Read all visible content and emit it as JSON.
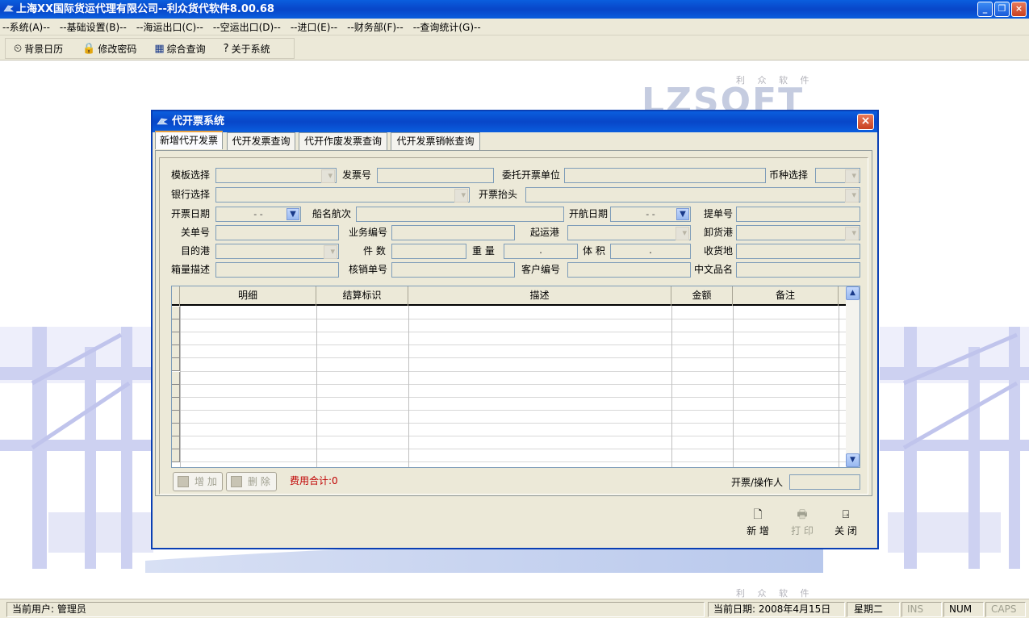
{
  "window": {
    "title": "上海XX国际货运代理有限公司--利众货代软件8.00.68"
  },
  "menu": [
    "--系统(A)--",
    "--基础设置(B)--",
    "--海运出口(C)--",
    "--空运出口(D)--",
    "--进口(E)--",
    "--财务部(F)--",
    "--查询统计(G)--"
  ],
  "toolbar": {
    "calendar": "背景日历",
    "password": "修改密码",
    "query": "综合查询",
    "about": "关于系统"
  },
  "logo": {
    "text": "LZSOFT",
    "sub": "利 众 软 件"
  },
  "dialog": {
    "title": "代开票系统",
    "tabs": [
      "新增代开发票",
      "代开发票查询",
      "代开作废发票查询",
      "代开发票销帐查询"
    ],
    "labels": {
      "template": "模板选择",
      "invoice_no": "发票号",
      "entrust_unit": "委托开票单位",
      "currency": "币种选择",
      "bank": "银行选择",
      "invoice_header": "开票抬头",
      "invoice_date": "开票日期",
      "vessel_voyage": "船名航次",
      "sail_date": "开航日期",
      "bill_no": "提单号",
      "customs_no": "关单号",
      "business_no": "业务编号",
      "load_port": "起运港",
      "discharge_port": "卸货港",
      "dest_port": "目的港",
      "pieces": "件  数",
      "weight": "重  量",
      "volume": "体  积",
      "delivery_place": "收货地",
      "box_desc": "箱量描述",
      "verification_no": "核销单号",
      "customer_no": "客户编号",
      "cn_name": "中文品名"
    },
    "date_placeholder": "-  -",
    "decimal_placeholder": ".",
    "grid": {
      "columns": [
        "明细",
        "结算标识",
        "描述",
        "金额",
        "备注"
      ],
      "rows": 12
    },
    "buttons": {
      "add_row": "增 加",
      "delete_row": "删 除",
      "new": "新 增",
      "print": "打 印",
      "close": "关 闭"
    },
    "fee_total": "费用合计:0",
    "operator_label": "开票/操作人"
  },
  "status": {
    "user": "当前用户: 管理员",
    "date": "当前日期: 2008年4月15日",
    "weekday": "星期二",
    "ins": "INS",
    "num": "NUM",
    "caps": "CAPS"
  }
}
